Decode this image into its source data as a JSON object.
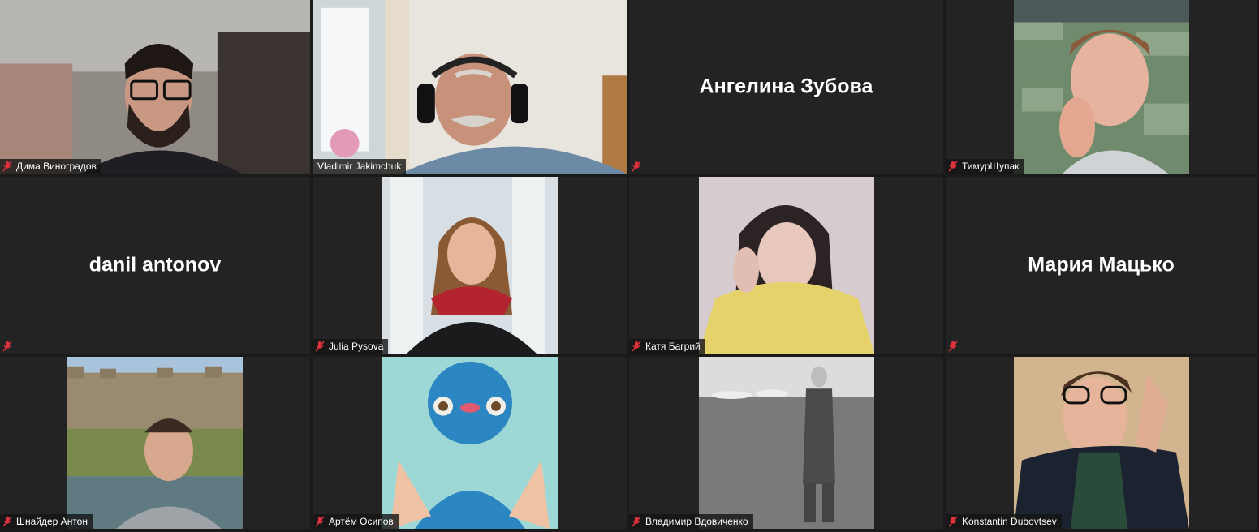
{
  "app": {
    "view": "gallery"
  },
  "participants": [
    {
      "name": "Дима Виноградов",
      "muted": true,
      "video": "on"
    },
    {
      "name": "Vladimir Jakimchuk",
      "muted": false,
      "video": "on",
      "active_speaker": true
    },
    {
      "name": "Ангелина Зубова",
      "muted": true,
      "video": "off"
    },
    {
      "name": "ТимурЩупак",
      "muted": true,
      "video": "on"
    },
    {
      "name": "danil antonov",
      "muted": true,
      "video": "off"
    },
    {
      "name": "Julia Pysova",
      "muted": true,
      "video": "on"
    },
    {
      "name": "Катя Багрий",
      "muted": true,
      "video": "on"
    },
    {
      "name": "Мария Мацько",
      "muted": true,
      "video": "off"
    },
    {
      "name": "Шнайдер Антон",
      "muted": true,
      "video": "on"
    },
    {
      "name": "Артём Осипов",
      "muted": true,
      "video": "on"
    },
    {
      "name": "Владимир Вдовиченко",
      "muted": true,
      "video": "on"
    },
    {
      "name": "Konstantin Dubovtsev",
      "muted": true,
      "video": "on"
    }
  ],
  "colors": {
    "tile_bg": "#232323",
    "active_speaker_border": "#c9e84a",
    "muted_icon": "#e0333d"
  },
  "icons": {
    "muted": "mic-muted-icon"
  }
}
